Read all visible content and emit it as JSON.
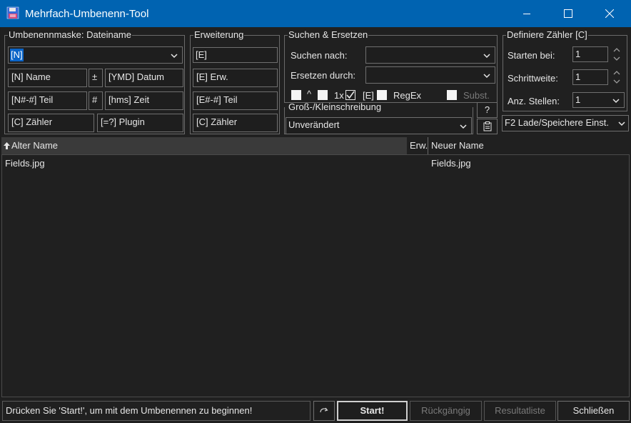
{
  "window": {
    "title": "Mehrfach-Umbenenn-Tool"
  },
  "mask": {
    "legend": "Umbenennmaske: Dateiname",
    "value": "[N]",
    "btn_name": "[N]  Name",
    "btn_plusminus": "±",
    "btn_date": "[YMD]  Datum",
    "btn_part": "[N#-#] Teil",
    "btn_hash": "#",
    "btn_time": "[hms]  Zeit",
    "btn_counter": "[C]  Zähler",
    "btn_plugin": "[=?]  Plugin"
  },
  "ext": {
    "legend": "Erweiterung",
    "value": "[E]",
    "btn_ext": "[E]  Erw.",
    "btn_part": "[E#-#] Teil",
    "btn_counter": "[C]  Zähler"
  },
  "search": {
    "legend": "Suchen & Ersetzen",
    "find_label": "Suchen nach:",
    "find_value": "",
    "replace_label": "Ersetzen durch:",
    "replace_value": "",
    "opt_caret": "^",
    "opt_once": "1x",
    "opt_ext": "[E]",
    "opt_regex": "RegEx",
    "opt_subst": "Subst."
  },
  "case": {
    "legend": "Groß-/Kleinschreibung",
    "value": "Unverändert",
    "help_label": "?"
  },
  "counter": {
    "legend": "Definiere Zähler [C]",
    "start_label": "Starten bei:",
    "start_value": "1",
    "step_label": "Schrittweite:",
    "step_value": "1",
    "digits_label": "Anz. Stellen:",
    "digits_value": "1"
  },
  "settings": {
    "value": "F2 Lade/Speichere Einst."
  },
  "table": {
    "col_old": "Alter Name",
    "col_ext": "Erw.",
    "col_new": "Neuer Name",
    "rows": [
      {
        "old": "Fields.jpg",
        "new": "Fields.jpg"
      }
    ]
  },
  "status": {
    "text": "Drücken Sie 'Start!', um mit dem Umbenennen zu beginnen!",
    "start": "Start!",
    "undo": "Rückgängig",
    "results": "Resultatliste",
    "close": "Schließen"
  },
  "colors": {
    "titlebar": "#0063b1",
    "background": "#202020",
    "selection": "#0a64c8"
  }
}
